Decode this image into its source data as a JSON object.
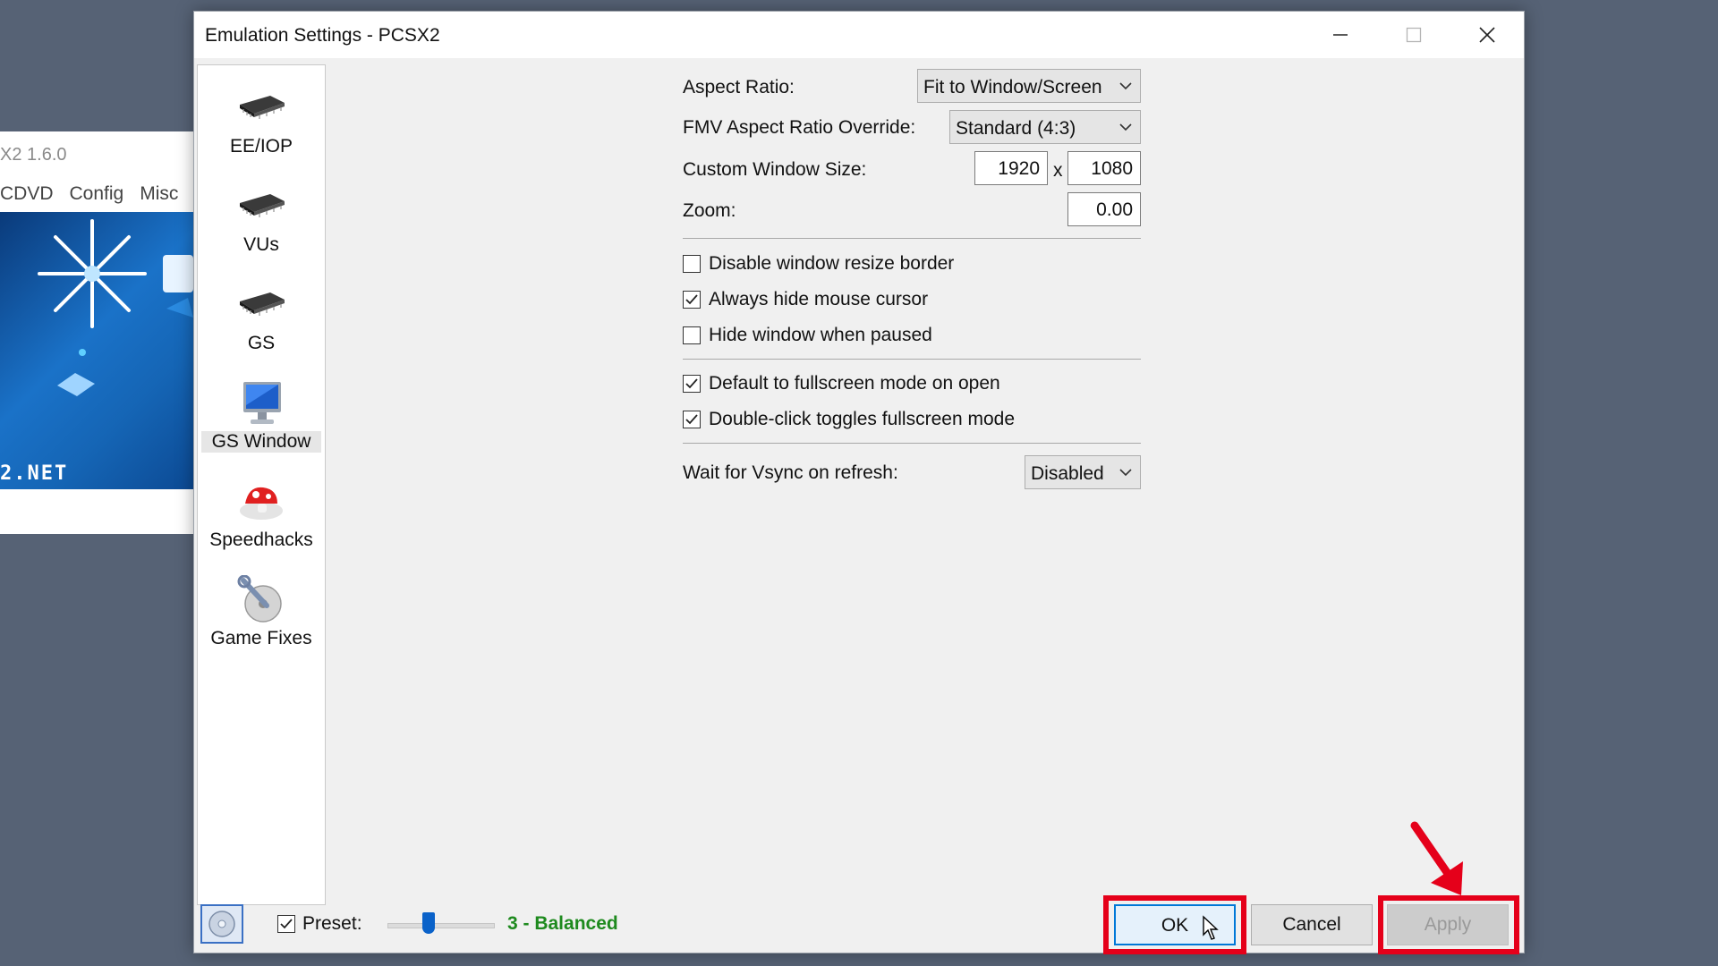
{
  "background_window": {
    "title": "X2  1.6.0",
    "menu": [
      "CDVD",
      "Config",
      "Misc"
    ],
    "logo_text": "2.NET"
  },
  "dialog": {
    "title": "Emulation Settings - PCSX2",
    "controls": {
      "minimize": "minimize-icon",
      "maximize": "maximize-icon",
      "close": "close-icon"
    }
  },
  "sidebar": {
    "items": [
      {
        "label": "EE/IOP",
        "icon": "chip-icon",
        "selected": false
      },
      {
        "label": "VUs",
        "icon": "chip-icon",
        "selected": false
      },
      {
        "label": "GS",
        "icon": "chip-icon",
        "selected": false
      },
      {
        "label": "GS Window",
        "icon": "monitor-icon",
        "selected": true
      },
      {
        "label": "Speedhacks",
        "icon": "mushroom-icon",
        "selected": false
      },
      {
        "label": "Game Fixes",
        "icon": "wrench-disc-icon",
        "selected": false
      }
    ]
  },
  "settings": {
    "aspect_ratio": {
      "label": "Aspect Ratio:",
      "value": "Fit to Window/Screen"
    },
    "fmv_aspect": {
      "label": "FMV Aspect Ratio Override:",
      "value": "Standard (4:3)"
    },
    "window_size": {
      "label": "Custom Window Size:",
      "width": "1920",
      "separator": "x",
      "height": "1080"
    },
    "zoom": {
      "label": "Zoom:",
      "value": "0.00"
    },
    "checkboxes": [
      {
        "label": "Disable window resize border",
        "checked": false
      },
      {
        "label": "Always hide mouse cursor",
        "checked": true
      },
      {
        "label": "Hide window when paused",
        "checked": false
      },
      {
        "label": "Default to fullscreen mode on open",
        "checked": true
      },
      {
        "label": "Double-click toggles fullscreen mode",
        "checked": true
      }
    ],
    "vsync": {
      "label": "Wait for Vsync on refresh:",
      "value": "Disabled"
    }
  },
  "footer": {
    "preset_label": "Preset:",
    "preset_checked": true,
    "preset_value": "3 - Balanced",
    "ok_label": "OK",
    "cancel_label": "Cancel",
    "apply_label": "Apply"
  },
  "colors": {
    "desktop": "#566275",
    "highlight_box": "#e5001a",
    "preset_text": "#1e8a1e",
    "ok_border": "#0078d7"
  }
}
